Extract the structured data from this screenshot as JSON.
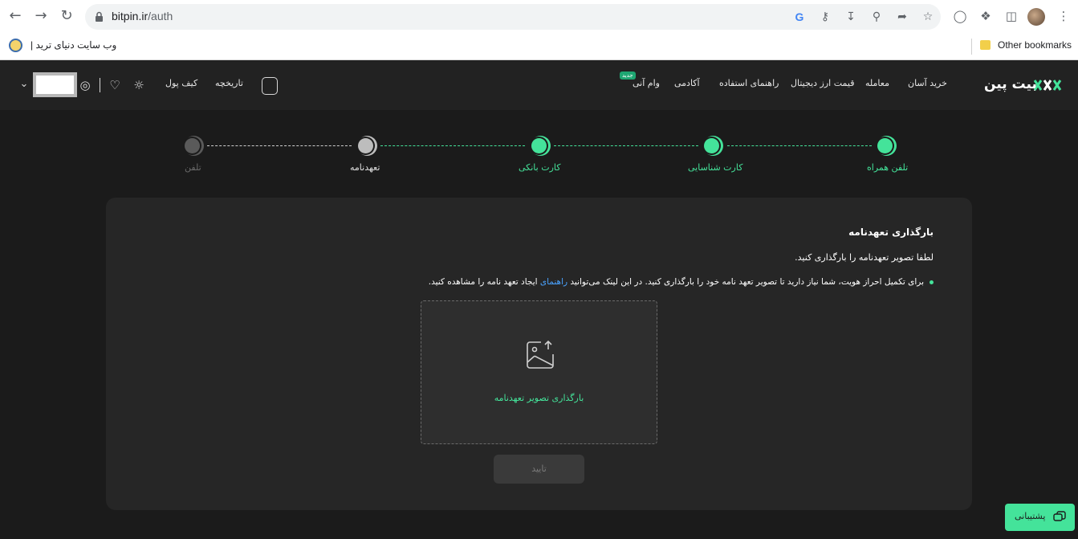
{
  "browser": {
    "url_domain": "bitpin.ir",
    "url_path": "/auth",
    "bookmark": "وب سایت دنیای ترید |",
    "other_bookmarks": "Other bookmarks"
  },
  "header": {
    "logo": "بیت پین",
    "menu": [
      "خرید آسان",
      "معامله",
      "قیمت ارز دیجیتال",
      "راهنمای استفاده",
      "آکادمی",
      "وام آنی"
    ],
    "new_badge": "جدید",
    "history": "تاریخچه",
    "wallet": "کیف پول"
  },
  "stepper": {
    "steps": [
      {
        "label": "تلفن همراه",
        "state": "done"
      },
      {
        "label": "کارت شناسایی",
        "state": "done"
      },
      {
        "label": "کارت بانکی",
        "state": "done"
      },
      {
        "label": "تعهدنامه",
        "state": "current"
      },
      {
        "label": "تلفن",
        "state": "pending"
      }
    ]
  },
  "card": {
    "title": "بارگذاری تعهدنامه",
    "subtitle": "لطفا تصویر تعهدنامه را بارگذاری کنید.",
    "note_before": "برای تکمیل احراز هویت، شما نیاز دارید تا تصویر تعهد نامه خود را بارگذاری کنید. در این لینک می‌توانید ",
    "note_link": "راهنمای",
    "note_after": " ایجاد تعهد نامه را مشاهده کنید.",
    "upload_label": "بارگذاری تصویر تعهدنامه",
    "confirm": "تایید"
  },
  "support": {
    "label": "پشتیبانی"
  },
  "colors": {
    "accent": "#44e39a",
    "link": "#4aa3ff",
    "background": "#1b1b1b",
    "card": "#262626"
  }
}
